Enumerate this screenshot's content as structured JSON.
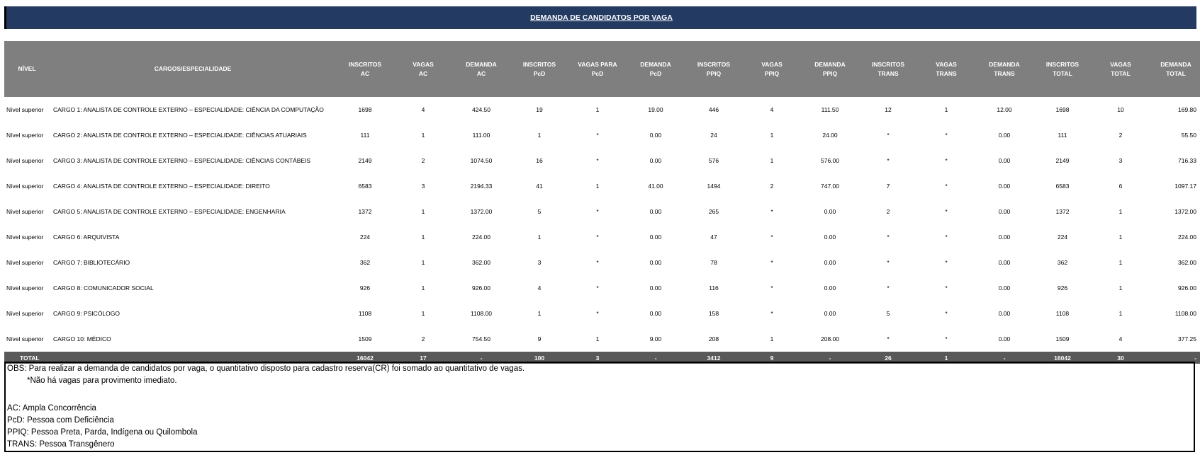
{
  "title": "DEMANDA DE CANDIDATOS POR VAGA",
  "headers": {
    "nivel": "NÍVEL",
    "cargo": "CARGOS/ESPECIALIDADE",
    "insc_ac": [
      "INSCRITOS",
      "AC"
    ],
    "vagas_ac": [
      "VAGAS",
      "AC"
    ],
    "dem_ac": [
      "DEMANDA",
      "AC"
    ],
    "insc_pcd": [
      "INSCRITOS",
      "PcD"
    ],
    "vagas_pcd": [
      "VAGAS PARA",
      "PcD"
    ],
    "dem_pcd": [
      "DEMANDA",
      "PcD"
    ],
    "insc_ppiq": [
      "INSCRITOS",
      "PPIQ"
    ],
    "vagas_ppiq": [
      "VAGAS",
      "PPIQ"
    ],
    "dem_ppiq": [
      "DEMANDA",
      "PPIQ"
    ],
    "insc_trans": [
      "INSCRITOS",
      "TRANS"
    ],
    "vagas_trans": [
      "VAGAS",
      "TRANS"
    ],
    "dem_trans": [
      "DEMANDA",
      "TRANS"
    ],
    "insc_total": [
      "INSCRITOS",
      "TOTAL"
    ],
    "vagas_total": [
      "VAGAS",
      "TOTAL"
    ],
    "dem_total": [
      "DEMANDA",
      "TOTAL"
    ]
  },
  "rows": [
    [
      "Nível superior",
      "CARGO 1: ANALISTA DE CONTROLE EXTERNO – ESPECIALIDADE: CIÊNCIA DA COMPUTAÇÃO",
      "1698",
      "4",
      "424.50",
      "19",
      "1",
      "19.00",
      "446",
      "4",
      "111.50",
      "12",
      "1",
      "12.00",
      "1698",
      "10",
      "169.80"
    ],
    [
      "Nível superior",
      "CARGO 2: ANALISTA DE CONTROLE EXTERNO – ESPECIALIDADE: CIÊNCIAS ATUARIAIS",
      "111",
      "1",
      "111.00",
      "1",
      "*",
      "0.00",
      "24",
      "1",
      "24.00",
      "*",
      "*",
      "0.00",
      "111",
      "2",
      "55.50"
    ],
    [
      "Nível superior",
      "CARGO 3: ANALISTA DE CONTROLE EXTERNO – ESPECIALIDADE: CIÊNCIAS CONTÁBEIS",
      "2149",
      "2",
      "1074.50",
      "16",
      "*",
      "0.00",
      "576",
      "1",
      "576.00",
      "*",
      "*",
      "0.00",
      "2149",
      "3",
      "716.33"
    ],
    [
      "Nível superior",
      "CARGO 4: ANALISTA DE CONTROLE EXTERNO – ESPECIALIDADE: DIREITO",
      "6583",
      "3",
      "2194.33",
      "41",
      "1",
      "41.00",
      "1494",
      "2",
      "747.00",
      "7",
      "*",
      "0.00",
      "6583",
      "6",
      "1097.17"
    ],
    [
      "Nível superior",
      "CARGO 5: ANALISTA DE CONTROLE EXTERNO – ESPECIALIDADE: ENGENHARIA",
      "1372",
      "1",
      "1372.00",
      "5",
      "*",
      "0.00",
      "265",
      "*",
      "0.00",
      "2",
      "*",
      "0.00",
      "1372",
      "1",
      "1372.00"
    ],
    [
      "Nível superior",
      "CARGO 6: ARQUIVISTA",
      "224",
      "1",
      "224.00",
      "1",
      "*",
      "0.00",
      "47",
      "*",
      "0.00",
      "*",
      "*",
      "0.00",
      "224",
      "1",
      "224.00"
    ],
    [
      "Nível superior",
      "CARGO 7: BIBLIOTECÁRIO",
      "362",
      "1",
      "362.00",
      "3",
      "*",
      "0.00",
      "78",
      "*",
      "0.00",
      "*",
      "*",
      "0.00",
      "362",
      "1",
      "362.00"
    ],
    [
      "Nível superior",
      "CARGO 8: COMUNICADOR SOCIAL",
      "926",
      "1",
      "926.00",
      "4",
      "*",
      "0.00",
      "116",
      "*",
      "0.00",
      "*",
      "*",
      "0.00",
      "926",
      "1",
      "926.00"
    ],
    [
      "Nível superior",
      "CARGO 9: PSICÓLOGO",
      "1108",
      "1",
      "1108.00",
      "1",
      "*",
      "0.00",
      "158",
      "*",
      "0.00",
      "5",
      "*",
      "0.00",
      "1108",
      "1",
      "1108.00"
    ],
    [
      "Nível superior",
      "CARGO 10: MÉDICO",
      "1509",
      "2",
      "754.50",
      "9",
      "1",
      "9.00",
      "208",
      "1",
      "208.00",
      "*",
      "*",
      "0.00",
      "1509",
      "4",
      "377.25"
    ]
  ],
  "total": [
    "TOTAL",
    "",
    "16042",
    "17",
    "-",
    "100",
    "3",
    "-",
    "3412",
    "9",
    "-",
    "26",
    "1",
    "-",
    "16042",
    "30",
    "-"
  ],
  "notes": {
    "obs": "OBS: Para realizar a demanda de candidatos por vaga, o quantitativo disposto para cadastro reserva(CR) foi somado ao quantitativo de vagas.",
    "no_vacancy": "*Não há vagas para provimento imediato.",
    "legend": [
      "AC: Ampla Concorrência",
      "PcD: Pessoa com Deficiência",
      "PPIQ: Pessoa Preta, Parda, Indígena ou Quilombola",
      "TRANS: Pessoa Transgênero"
    ]
  }
}
